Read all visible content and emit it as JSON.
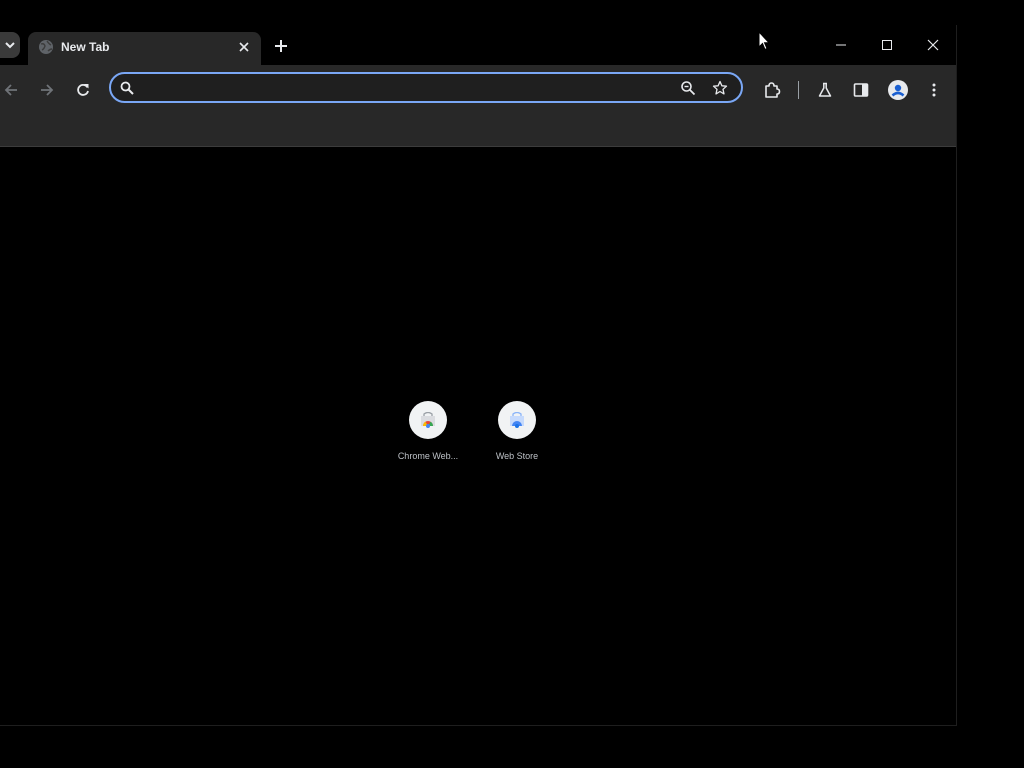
{
  "tabs": [
    {
      "title": "New Tab",
      "favicon": "globe-icon",
      "active": true
    }
  ],
  "omnibox": {
    "value": "",
    "placeholder": ""
  },
  "shortcuts": [
    {
      "label": "Chrome Web...",
      "icon": "chrome-web-store-icon"
    },
    {
      "label": "Web Store",
      "icon": "web-store-icon"
    }
  ],
  "colors": {
    "toolbar": "#282828",
    "omnibox_border": "#7aa7f5",
    "page_bg": "#000000",
    "tab_bg": "#282828"
  }
}
